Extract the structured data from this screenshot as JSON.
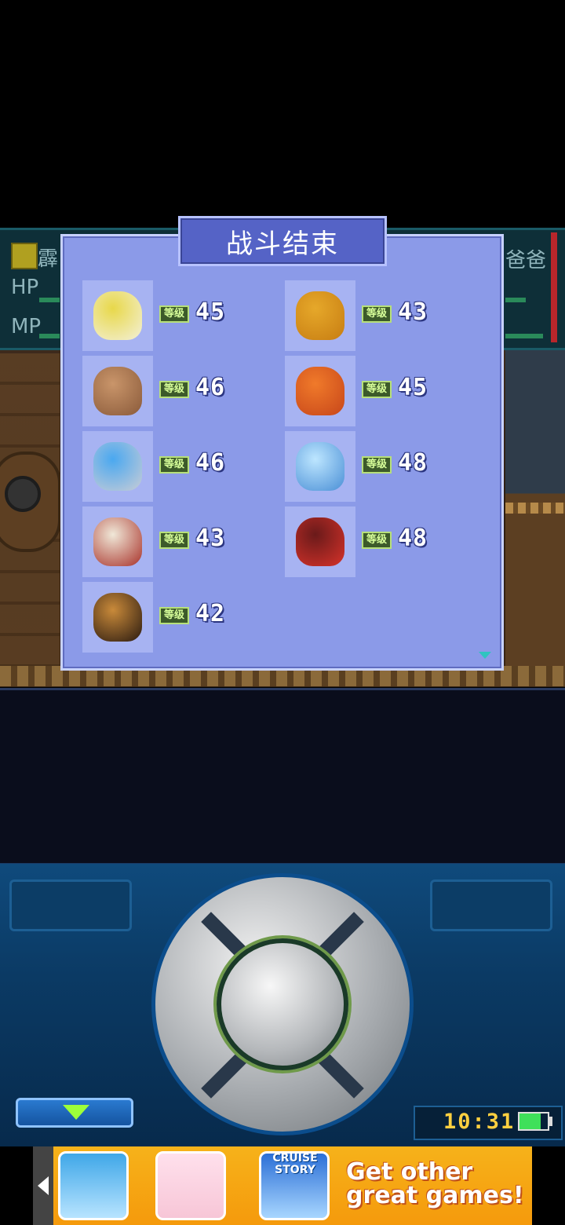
{
  "hud": {
    "name_left": "霹",
    "name_right": "爸爸",
    "hp_label": "HP",
    "mp_label": "MP"
  },
  "dialog": {
    "title": "战斗结束",
    "level_label": "等级",
    "monsters": [
      {
        "icon": "spider-monster-icon",
        "level": "45"
      },
      {
        "icon": "lion-monster-icon",
        "level": "43"
      },
      {
        "icon": "block-face-monster-icon",
        "level": "46"
      },
      {
        "icon": "fire-dragon-monster-icon",
        "level": "45"
      },
      {
        "icon": "ufo-monster-icon",
        "level": "46"
      },
      {
        "icon": "ice-dragon-monster-icon",
        "level": "48"
      },
      {
        "icon": "skeleton-monster-icon",
        "level": "43"
      },
      {
        "icon": "dark-beast-monster-icon",
        "level": "48"
      },
      {
        "icon": "box-bat-monster-icon",
        "level": "42"
      }
    ]
  },
  "status": {
    "clock": "10:31",
    "battery_level": 0.75
  },
  "ad": {
    "cruise_label": "CRUISE STORY",
    "line1": "Get other",
    "line2": "great games!"
  },
  "colors": {
    "dialog_bg": "#8b9ae8",
    "title_bg": "#5563c6",
    "clock": "#ffd040",
    "ad_bg": "#f59a0c"
  }
}
